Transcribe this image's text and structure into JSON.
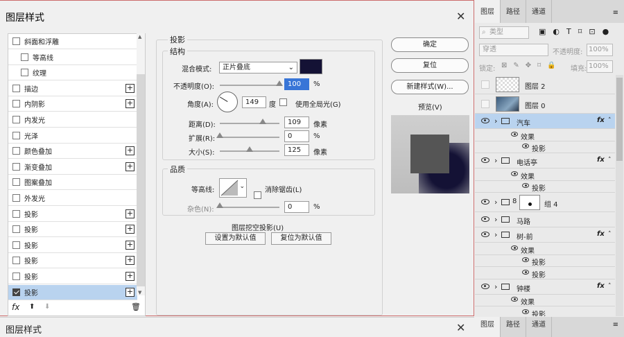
{
  "dialog": {
    "title": "图层样式",
    "close_glyph": "✕"
  },
  "style_list": [
    {
      "label": "斜面和浮雕",
      "checked": false,
      "indent": false,
      "plus": false
    },
    {
      "label": "等高线",
      "checked": false,
      "indent": true,
      "plus": false
    },
    {
      "label": "纹理",
      "checked": false,
      "indent": true,
      "plus": false
    },
    {
      "label": "描边",
      "checked": false,
      "indent": false,
      "plus": true
    },
    {
      "label": "内阴影",
      "checked": false,
      "indent": false,
      "plus": true
    },
    {
      "label": "内发光",
      "checked": false,
      "indent": false,
      "plus": false
    },
    {
      "label": "光泽",
      "checked": false,
      "indent": false,
      "plus": false
    },
    {
      "label": "颜色叠加",
      "checked": false,
      "indent": false,
      "plus": true
    },
    {
      "label": "渐变叠加",
      "checked": false,
      "indent": false,
      "plus": true
    },
    {
      "label": "图案叠加",
      "checked": false,
      "indent": false,
      "plus": false
    },
    {
      "label": "外发光",
      "checked": false,
      "indent": false,
      "plus": false
    },
    {
      "label": "投影",
      "checked": false,
      "indent": false,
      "plus": true
    },
    {
      "label": "投影",
      "checked": false,
      "indent": false,
      "plus": true
    },
    {
      "label": "投影",
      "checked": false,
      "indent": false,
      "plus": true
    },
    {
      "label": "投影",
      "checked": false,
      "indent": false,
      "plus": true
    },
    {
      "label": "投影",
      "checked": false,
      "indent": false,
      "plus": true
    },
    {
      "label": "投影",
      "checked": true,
      "indent": false,
      "plus": true,
      "selected": true
    }
  ],
  "list_footer": {
    "fx": "fx",
    "up": "⬆",
    "down": "⬇",
    "trash": "🗑"
  },
  "shadow": {
    "section_title": "投影",
    "structure_title": "结构",
    "blend_label": "混合模式:",
    "blend_value": "正片叠底",
    "blend_color": "#141235",
    "opacity_label": "不透明度(O):",
    "opacity_value": "100",
    "opacity_pct": 100,
    "pct": "%",
    "angle_label": "角度(A):",
    "angle_value": "149",
    "angle_unit": "度",
    "global_light_label": "使用全局光(G)",
    "global_light": false,
    "distance_label": "距离(D):",
    "distance_value": "109",
    "distance_unit": "像素",
    "spread_label": "扩展(R):",
    "spread_value": "0",
    "spread_unit": "%",
    "size_label": "大小(S):",
    "size_value": "125",
    "size_unit": "像素",
    "quality_title": "品质",
    "contour_label": "等高线:",
    "antialias_label": "消除锯齿(L)",
    "noise_label": "杂色(N):",
    "noise_value": "0",
    "noise_unit": "%",
    "knockout_label": "图层挖空投影(U)",
    "knockout": true,
    "set_default": "设置为默认值",
    "reset_default": "复位为默认值"
  },
  "buttons": {
    "ok": "确定",
    "reset": "复位",
    "new_style": "新建样式(W)...",
    "preview_label": "预览(V)",
    "preview": true
  },
  "panel": {
    "tabs": [
      "图层",
      "路径",
      "通道"
    ],
    "kind_label": "类型",
    "blend": "穿透",
    "opacity_label": "不透明度:",
    "opacity": "100%",
    "lock_label": "锁定:",
    "fill_label": "填充:",
    "fill": "100%",
    "layers": [
      {
        "name": "图层 2",
        "type": "thumb-checker",
        "eye": false
      },
      {
        "name": "图层 0",
        "type": "thumb-photo",
        "eye": false
      },
      {
        "name": "汽车",
        "type": "folder",
        "eye": true,
        "fx": true,
        "selected": true
      },
      {
        "name": "效果",
        "type": "effects",
        "eye": true
      },
      {
        "name": "投影",
        "type": "effect",
        "eye": true
      },
      {
        "name": "电话亭",
        "type": "folder",
        "eye": true,
        "fx": true
      },
      {
        "name": "效果",
        "type": "effects",
        "eye": true
      },
      {
        "name": "投影",
        "type": "effect",
        "eye": true
      },
      {
        "name": "组 4",
        "type": "group-mask",
        "eye": true
      },
      {
        "name": "马路",
        "type": "folder",
        "eye": true
      },
      {
        "name": "树-前",
        "type": "folder",
        "eye": true,
        "fx": true
      },
      {
        "name": "效果",
        "type": "effects",
        "eye": true
      },
      {
        "name": "投影",
        "type": "effect",
        "eye": true
      },
      {
        "name": "投影",
        "type": "effect",
        "eye": true
      },
      {
        "name": "钟楼",
        "type": "folder",
        "eye": true,
        "fx": true
      },
      {
        "name": "效果",
        "type": "effects",
        "eye": true
      },
      {
        "name": "投影",
        "type": "effect",
        "eye": true
      },
      {
        "name": "投影",
        "type": "effect",
        "eye": true
      }
    ],
    "fx_label": "fx"
  },
  "bottom": {
    "dialog_title": "图层样式",
    "close_glyph": "✕",
    "tabs": [
      "图层",
      "路径",
      "通道"
    ]
  }
}
